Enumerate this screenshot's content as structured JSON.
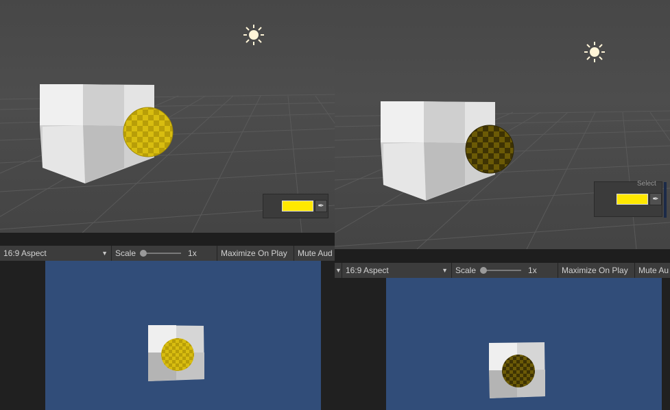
{
  "panels": [
    {
      "id": "left",
      "toolbar": {
        "aspect_label": "16:9 Aspect",
        "scale_label": "Scale",
        "scale_value": "1x",
        "maximize_label": "Maximize On Play",
        "mute_label": "Mute Aud"
      },
      "sphere_appearance": "bright"
    },
    {
      "id": "right",
      "toolbar": {
        "aspect_label": "16:9 Aspect",
        "scale_label": "Scale",
        "scale_value": "1x",
        "maximize_label": "Maximize On Play",
        "mute_label": "Mute Au"
      },
      "select_label": "Select",
      "sphere_appearance": "dark"
    }
  ],
  "colors": {
    "scene_bg": "#474747",
    "game_bg": "#314d79",
    "swatch": "#ffe800",
    "sphere_light": "#e0c21a",
    "sphere_dark": "#4a3d05"
  },
  "icons": {
    "light": "sun-icon",
    "eyedropper": "eyedropper-icon",
    "dropdown": "caret-down-icon"
  }
}
